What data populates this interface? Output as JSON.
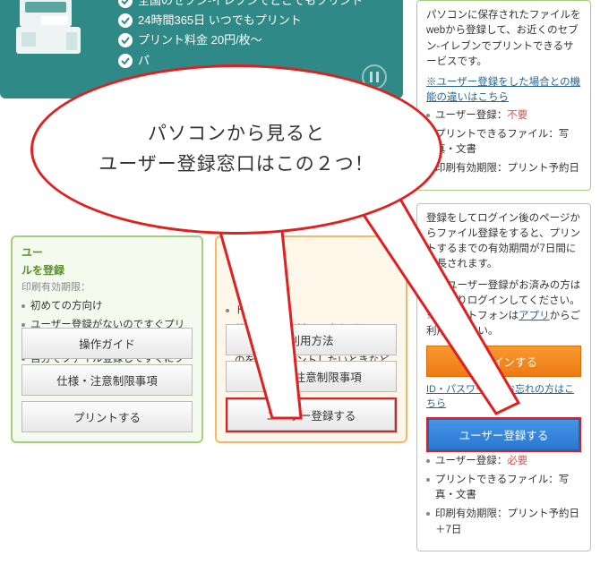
{
  "hero": {
    "bullets": [
      "全国のセブン-イレブンでどこでもプリント",
      "24時間365日 いつでもプリント",
      "プリント料金 20円/枚〜",
      "パ"
    ]
  },
  "balloon": {
    "line1": "パソコンから見ると",
    "line2": "ユーザー登録窓口はこの２つ！"
  },
  "right_top": {
    "desc": "パソコンに保存されたファイルをwebから登録して、お近くのセブン-イレブンでプリントできるサービスです。",
    "link": "※ユーザー登録をした場合との機能の違いはこちら",
    "reg_label": "ユーザー登録：",
    "reg_value": "不要",
    "bullets": [
      "プリントできるファイル：写真・文書",
      "印刷有効期限：プリント予約日"
    ]
  },
  "right_login": {
    "desc1": "登録をしてログイン後のページからファイル登録をすると、プリントするまでの有効期間が7日間に延長されます。",
    "desc2_a": "既にユーザー登録がお済みの方は下記よりログインしてください。",
    "desc2_b": "※スマートフォンは",
    "app_link": "アプリ",
    "desc2_c": "からご利用ください。",
    "login_btn": "ログインする",
    "forgot": "ID・パスワードをお忘れの方はこちら",
    "register_btn": "ユーザー登録する",
    "reg_label": "ユーザー登録：",
    "reg_value": "必要",
    "bullets": [
      "プリントできるファイル：写真・文書",
      "印刷有効期限：プリント予約日＋7日"
    ]
  },
  "card_left": {
    "title_a": "ユー",
    "title_b": "ルを登録",
    "sub": "印刷有効期限：",
    "items": [
      "初めての方向け",
      "ユーザー登録がないのですぐプリントできる",
      "自分でファイル登録してすぐにプリントしたいときにおすすめ"
    ],
    "btn1": "操作ガイド",
    "btn2": "仕様・注意制限事項",
    "btn3": "プリントする"
  },
  "card_mid": {
    "title": "",
    "items": [
      "ト",
      "共有したい資料、写真などをみんなに簡単にシェアしたり、同じものを複数プリントしたいときなどに便利"
    ],
    "btn1": "利用方法",
    "btn2": "仕様・注意制限事項",
    "btn3": "ユーザー登録する"
  }
}
